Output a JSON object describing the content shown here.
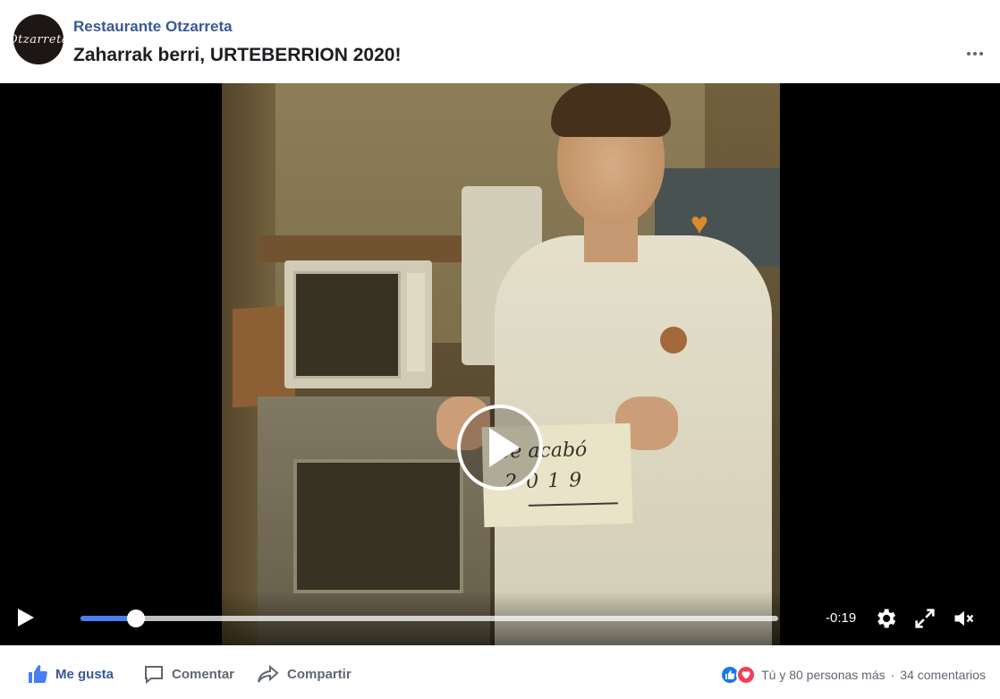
{
  "post": {
    "page_name": "Restaurante Otzarreta",
    "title": "Zaharrak berri, URTEBERRION 2020!",
    "avatar_text": "Otzarreta",
    "more_icon": "ellipsis-icon"
  },
  "video": {
    "sign_line1": "Se acabó",
    "sign_line2": "2019",
    "time_remaining": "-0:19",
    "progress_fraction": 0.079,
    "icons": {
      "play": "play-icon",
      "settings": "gear-icon",
      "fullscreen": "fullscreen-icon",
      "mute": "volume-muted-icon"
    },
    "accent": "#4a7cf3"
  },
  "actions": {
    "like_label": "Me gusta",
    "comment_label": "Comentar",
    "share_label": "Compartir"
  },
  "summary": {
    "reactions_text": "Tú y 80 personas más",
    "separator": "·",
    "comments_text": "34 comentarios"
  },
  "colors": {
    "link_blue": "#385898",
    "like_blue": "#1877f2",
    "love_red": "#f33e58"
  }
}
